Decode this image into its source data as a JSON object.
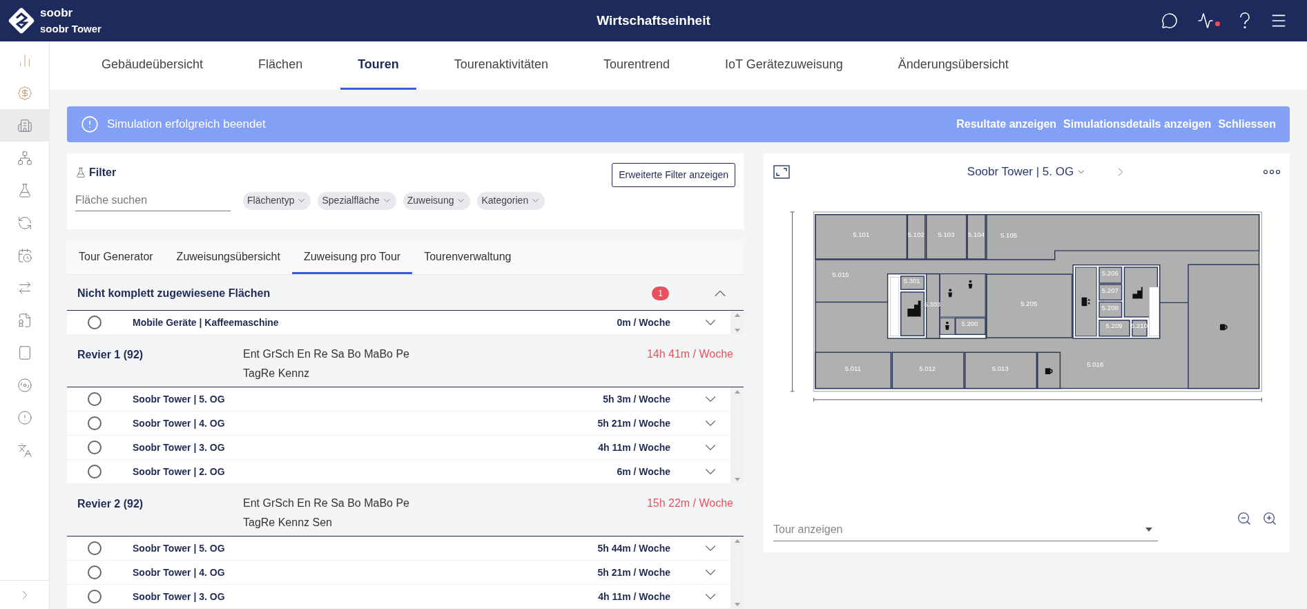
{
  "header": {
    "brand": "soobr",
    "building": "soobr Tower",
    "title": "Wirtschaftseinheit",
    "activity_alert": true
  },
  "sidebar_items": [
    {
      "selected": false
    },
    {
      "selected": false
    },
    {
      "selected": true
    },
    {
      "selected": false
    },
    {
      "selected": false
    },
    {
      "selected": false
    },
    {
      "selected": false
    },
    {
      "selected": false
    },
    {
      "selected": false
    },
    {
      "selected": false
    },
    {
      "selected": false
    },
    {
      "selected": false
    },
    {
      "selected": false
    }
  ],
  "nav_tabs": [
    {
      "label": "Gebäudeübersicht",
      "selected": false
    },
    {
      "label": "Flächen",
      "selected": false
    },
    {
      "label": "Touren",
      "selected": true
    },
    {
      "label": "Tourenaktivitäten",
      "selected": false
    },
    {
      "label": "Tourentrend",
      "selected": false
    },
    {
      "label": "IoT Gerätezuweisung",
      "selected": false
    },
    {
      "label": "Änderungsübersicht",
      "selected": false
    }
  ],
  "banner": {
    "message": "Simulation erfolgreich beendet",
    "actions": [
      "Resultate anzeigen",
      "Simulationsdetails anzeigen",
      "Schliessen"
    ]
  },
  "filter": {
    "title": "Filter",
    "advanced_button": "Erweiterte Filter anzeigen",
    "search_placeholder": "Fläche suchen",
    "chips": [
      "Flächentyp",
      "Spezialfläche",
      "Zuweisung",
      "Kategorien"
    ]
  },
  "sub_tabs": [
    {
      "label": "Tour Generator",
      "selected": false
    },
    {
      "label": "Zuweisungsübersicht",
      "selected": false
    },
    {
      "label": "Zuweisung pro Tour",
      "selected": true
    },
    {
      "label": "Tourenverwaltung",
      "selected": false
    }
  ],
  "groups": [
    {
      "kind": "unassigned",
      "title": "Nicht komplett zugewiesene Flächen",
      "badge": "1",
      "expanded": true,
      "rows": [
        {
          "name": "Mobile Geräte | Kaffeemaschine",
          "time": "0m / Woche",
          "selected": false,
          "expanded": false
        }
      ]
    },
    {
      "kind": "revier",
      "title": "Revier 1 (92)",
      "codes": [
        "Ent GrSch En Re Sa Bo MaBo Pe",
        "TagRe Kennz"
      ],
      "total": "14h 41m / Woche",
      "rows": [
        {
          "name": "Soobr Tower | 5. OG",
          "time": "5h 3m / Woche",
          "selected": false,
          "expanded": false
        },
        {
          "name": "Soobr Tower | 4. OG",
          "time": "5h 21m / Woche",
          "selected": false,
          "expanded": false
        },
        {
          "name": "Soobr Tower | 3. OG",
          "time": "4h 11m / Woche",
          "selected": false,
          "expanded": false
        },
        {
          "name": "Soobr Tower | 2. OG",
          "time": "6m / Woche",
          "selected": false,
          "expanded": false
        }
      ]
    },
    {
      "kind": "revier",
      "title": "Revier 2 (92)",
      "codes": [
        "Ent GrSch En Re Sa Bo MaBo Pe",
        "TagRe Kennz Sen"
      ],
      "total": "15h 22m / Woche",
      "rows": [
        {
          "name": "Soobr Tower | 5. OG",
          "time": "5h 44m / Woche",
          "selected": false,
          "expanded": false
        },
        {
          "name": "Soobr Tower | 4. OG",
          "time": "5h 21m / Woche",
          "selected": false,
          "expanded": false
        },
        {
          "name": "Soobr Tower | 3. OG",
          "time": "4h 11m / Woche",
          "selected": false,
          "expanded": false
        }
      ]
    }
  ],
  "map": {
    "floor": "Soobr Tower | 5. OG",
    "rooms": [
      "5.101",
      "5.102",
      "5.103",
      "5.104",
      "5.105",
      "5.015",
      "5.301",
      "5.303",
      "5.205",
      "5.206",
      "5.207",
      "5.208",
      "5.209",
      "5.210",
      "5.200",
      "5.011",
      "5.012",
      "5.013",
      "5.016"
    ],
    "tour_placeholder": "Tour anzeigen"
  }
}
